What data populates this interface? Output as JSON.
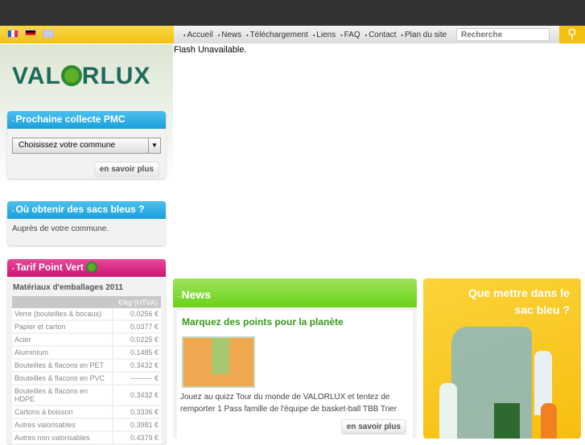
{
  "nav": {
    "items": [
      "Accueil",
      "News",
      "Téléchargement",
      "Liens",
      "FAQ",
      "Contact",
      "Plan du site"
    ],
    "search_placeholder": "Recherche"
  },
  "languages": [
    "fr",
    "de",
    "en"
  ],
  "flash_text": "Flash Unavailable.",
  "logo": "VALORLUX",
  "collecte": {
    "title": "Prochaine collecte PMC",
    "select_value": "Choisissez votre commune",
    "button": "en savoir plus"
  },
  "sacs": {
    "title": "Où obtenir des sacs bleus ?",
    "text": "Auprès de votre commune."
  },
  "tarif": {
    "title": "Tarif Point Vert",
    "subtitle": "Matériaux d'emballages  2011",
    "col_header": "€/kg (HTVA)",
    "rows": [
      [
        "Verre (bouteilles & bocaux)",
        "0.0256 €"
      ],
      [
        "Papier et carton",
        "0.0377 €"
      ],
      [
        "Acier",
        "0.0225 €"
      ],
      [
        "Aluminium",
        "0.1485 €"
      ],
      [
        "Bouteilles & flacons en PET",
        "0.3432 €"
      ],
      [
        "Bouteilles & flacons en PVC",
        "--------- €"
      ],
      [
        "Bouteilles & flacons en HDPE",
        "0.3432 €"
      ],
      [
        "Cartons à boisson",
        "0.3336 €"
      ],
      [
        "Autres valorisables",
        "0.3981 €"
      ],
      [
        "Autres non valorisables",
        "0.4379 €"
      ]
    ]
  },
  "news": {
    "title": "News",
    "headline": "Marquez des points pour la planète",
    "text": "Jouez au quizz Tour du monde de VALORLUX et tentez de remporter 1 Pass famille de l'équipe de basket-ball TBB Trier",
    "button": "en savoir plus"
  },
  "promo": {
    "title": "Que mettre dans le sac bleu ?"
  }
}
